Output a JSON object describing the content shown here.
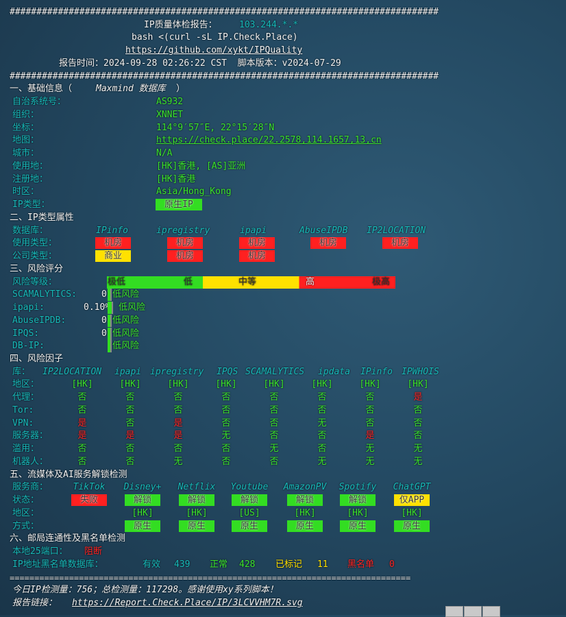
{
  "header": {
    "hash_line": "################################################################################",
    "title": "IP质量体检报告：",
    "ip": "103.244.*.*",
    "command": "bash <(curl -sL IP.Check.Place)",
    "repo_link": "https://github.com/xykt/IPQuality",
    "report_time": "报告时间：2024-09-28 02:26:22 CST  脚本版本：v2024-07-29"
  },
  "basic": {
    "title_pre": "一、基础信息（",
    "title_db": "Maxmind 数据库",
    "title_post": "）",
    "items": [
      {
        "label": "自治系统号：",
        "value": "AS932"
      },
      {
        "label": "组织：",
        "value": "XNNET"
      },
      {
        "label": "坐标：",
        "value": "114°9′57″E, 22°15′28″N"
      },
      {
        "label": "地图：",
        "value": "https://check.place/22.2578,114.1657,13,cn",
        "link": true
      },
      {
        "label": "城市：",
        "value": "N/A"
      },
      {
        "label": "使用地：",
        "value": "[HK]香港, [AS]亚洲"
      },
      {
        "label": "注册地：",
        "value": "[HK]香港"
      },
      {
        "label": "时区：",
        "value": "Asia/Hong_Kong"
      },
      {
        "label": "IP类型：",
        "value": "原生IP",
        "badge": "green"
      }
    ]
  },
  "ip_type": {
    "title": "二、IP类型属性",
    "db_label": "数据库：",
    "dbs": [
      "IPinfo",
      "ipregistry",
      "ipapi",
      "AbuseIPDB",
      "IP2LOCATION"
    ],
    "usage_label": "使用类型：",
    "usage": [
      "机房",
      "机房",
      "机房",
      "机房",
      "机房"
    ],
    "company_label": "公司类型：",
    "company": [
      "商业",
      "机房",
      "机房",
      null,
      null
    ],
    "company_colors": [
      "yellow",
      "red",
      "red"
    ]
  },
  "risk": {
    "title": "三、风险评分",
    "level_label": "风险等级：",
    "scale": [
      "极低",
      "低",
      "中等",
      "高",
      "极高"
    ],
    "scores": [
      {
        "label": "SCAMALYTICS:",
        "value": "0",
        "text": "低风险"
      },
      {
        "label": "ipapi:",
        "value": "0.10%",
        "text": "低风险"
      },
      {
        "label": "AbuseIPDB:",
        "value": "0",
        "text": "低风险"
      },
      {
        "label": "IPQS:",
        "value": "0",
        "text": "低风险"
      },
      {
        "label": "DB-IP:",
        "value": "",
        "text": "低风险"
      }
    ]
  },
  "factors": {
    "title": "四、风险因子",
    "lib_label": "库：",
    "dbs": [
      "IP2LOCATION",
      "ipapi",
      "ipregistry",
      "IPQS",
      "SCAMALYTICS",
      "ipdata",
      "IPinfo",
      "IPWHOIS"
    ],
    "rows": [
      {
        "label": "地区：",
        "values": [
          "[HK]",
          "[HK]",
          "[HK]",
          "[HK]",
          "[HK]",
          "[HK]",
          "[HK]",
          "[HK]"
        ]
      },
      {
        "label": "代理：",
        "values": [
          "否",
          "否",
          "否",
          "否",
          "否",
          "否",
          "否",
          "是"
        ]
      },
      {
        "label": "Tor:",
        "values": [
          "否",
          "否",
          "否",
          "否",
          "否",
          "否",
          "否",
          "否"
        ]
      },
      {
        "label": "VPN:",
        "values": [
          "是",
          "否",
          "是",
          "否",
          "否",
          "无",
          "否",
          "否"
        ]
      },
      {
        "label": "服务器：",
        "values": [
          "是",
          "是",
          "是",
          "无",
          "否",
          "否",
          "是",
          "否"
        ]
      },
      {
        "label": "滥用：",
        "values": [
          "否",
          "否",
          "否",
          "否",
          "无",
          "否",
          "无",
          "无"
        ]
      },
      {
        "label": "机器人：",
        "values": [
          "否",
          "否",
          "无",
          "否",
          "否",
          "无",
          "无",
          "无"
        ]
      }
    ]
  },
  "streaming": {
    "title": "五、流媒体及AI服务解锁检测",
    "provider_label": "服务商：",
    "services": [
      {
        "name": "TikTok",
        "status": "失败",
        "color": "red",
        "region": "",
        "method": ""
      },
      {
        "name": "Disney+",
        "status": "解锁",
        "color": "green",
        "region": "[HK]",
        "method": "原生"
      },
      {
        "name": "Netflix",
        "status": "解锁",
        "color": "green",
        "region": "[HK]",
        "method": "原生"
      },
      {
        "name": "Youtube",
        "status": "解锁",
        "color": "green",
        "region": "[US]",
        "method": "原生"
      },
      {
        "name": "AmazonPV",
        "status": "解锁",
        "color": "green",
        "region": "[HK]",
        "method": "原生"
      },
      {
        "name": "Spotify",
        "status": "解锁",
        "color": "green",
        "region": "[HK]",
        "method": "原生"
      },
      {
        "name": "ChatGPT",
        "status": "仅APP",
        "color": "yellow",
        "region": "[HK]",
        "method": "原生"
      }
    ],
    "status_label": "状态：",
    "region_label": "地区：",
    "method_label": "方式："
  },
  "mail": {
    "title": "六、邮局连通性及黑名单检测",
    "port_label": "本地25端口：",
    "port_value": "阻断",
    "bl_label": "IP地址黑名单数据库：",
    "valid_label": "有效",
    "valid": "439",
    "normal_label": "正常",
    "normal": "428",
    "marked_label": "已标记",
    "marked": "11",
    "black_label": "黑名单",
    "black": "0"
  },
  "footer": {
    "eq_line": "=================================================================================",
    "stats": "今日IP检测量：756；总检测量：117298。感谢使用xy系列脚本！",
    "link_label": "报告链接：",
    "link": "https://Report.Check.Place/IP/3LCVVHM7R.svg"
  },
  "colors": {
    "cyan": "#17b9b9",
    "green": "#3be32c",
    "red": "#ff2323",
    "yellow": "#ffe100"
  }
}
